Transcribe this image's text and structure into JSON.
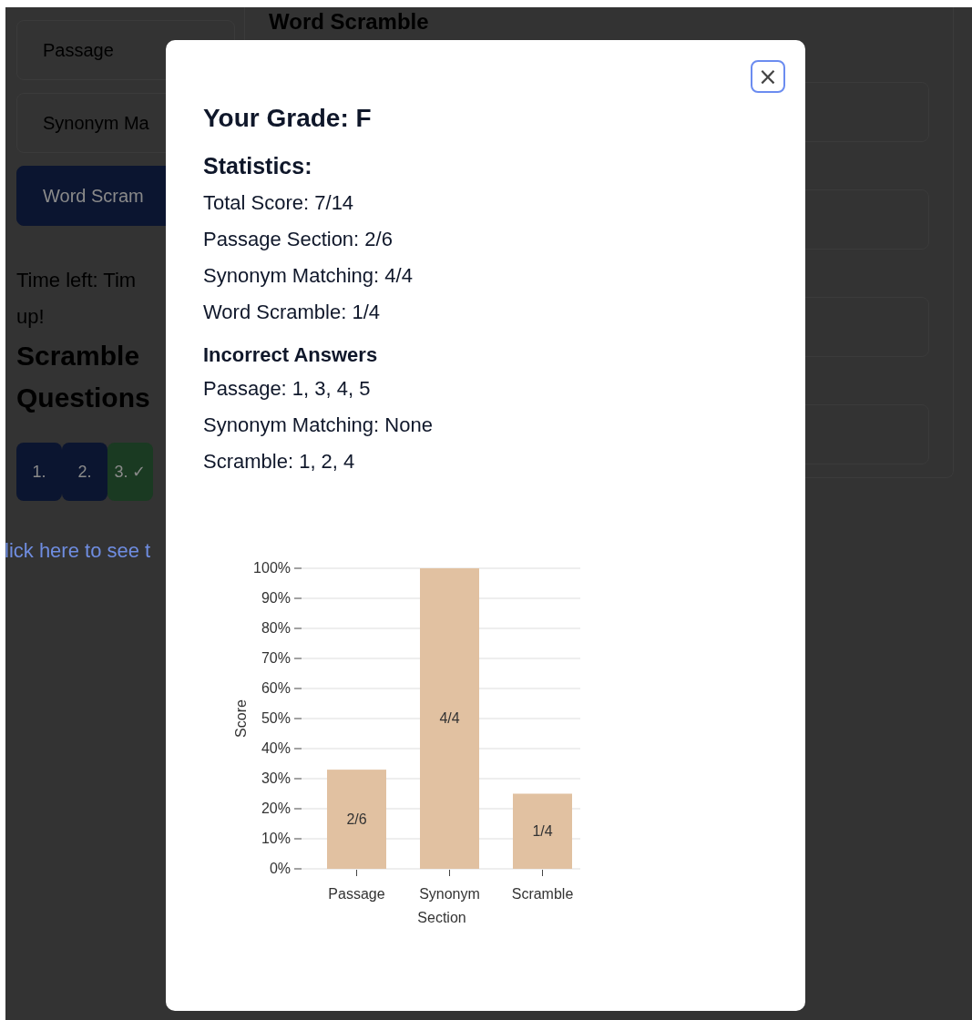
{
  "background": {
    "sections": [
      {
        "label": "Passage",
        "selected": false
      },
      {
        "label": "Synonym Ma",
        "selected": false
      },
      {
        "label": "Word Scram",
        "selected": true
      }
    ],
    "timer": [
      "Time left: Tim",
      "up!"
    ],
    "questions_heading": "Scramble Questions",
    "questions": [
      {
        "label": "1.",
        "correct": false
      },
      {
        "label": "2.",
        "correct": false
      },
      {
        "label": "3. ✓",
        "correct": true
      }
    ],
    "link": "lick here to see t",
    "main_heading": "Word Scramble"
  },
  "modal": {
    "close": "×",
    "grade": "Your Grade: F",
    "stats_heading": "Statistics:",
    "stats": [
      "Total Score: 7/14",
      "Passage Section: 2/6",
      "Synonym Matching: 4/4",
      "Word Scramble: 1/4"
    ],
    "incorrect_heading": "Incorrect Answers",
    "incorrect": [
      "Passage: 1, 3, 4, 5",
      "Synonym Matching: None",
      "Scramble: 1, 2, 4"
    ],
    "chart_data": {
      "type": "bar",
      "xlabel": "Section",
      "ylabel": "Score",
      "categories": [
        "Passage",
        "Synonym",
        "Scramble"
      ],
      "values": [
        33,
        100,
        25
      ],
      "ylim": [
        0,
        100
      ],
      "grid": true,
      "yticks": [
        {
          "value": 0,
          "label": "0%"
        },
        {
          "value": 10,
          "label": "10%"
        },
        {
          "value": 20,
          "label": "20%"
        },
        {
          "value": 30,
          "label": "30%"
        },
        {
          "value": 40,
          "label": "40%"
        },
        {
          "value": 50,
          "label": "50%"
        },
        {
          "value": 60,
          "label": "60%"
        },
        {
          "value": 70,
          "label": "70%"
        },
        {
          "value": 80,
          "label": "80%"
        },
        {
          "value": 90,
          "label": "90%"
        },
        {
          "value": 100,
          "label": "100%"
        }
      ],
      "annotations": [
        "2/6",
        "4/4",
        "1/4"
      ]
    }
  }
}
